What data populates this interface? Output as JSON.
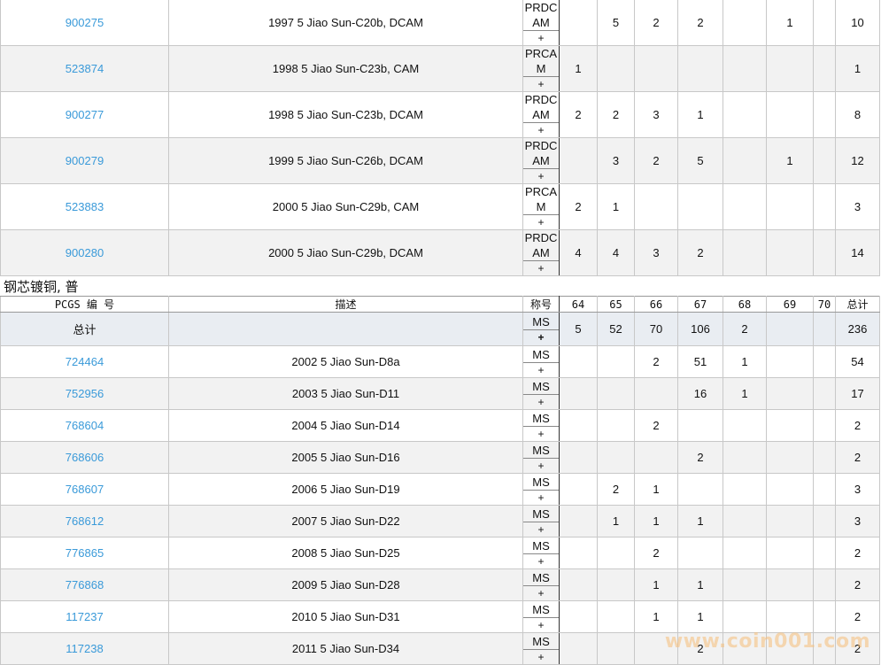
{
  "top_table": {
    "rows": [
      {
        "id": "900275",
        "desc": "1997 5 Jiao Sun-C20b, DCAM",
        "grade": "PRDCAM",
        "plus": "+",
        "g64": "",
        "g65": "5",
        "g66": "2",
        "g67": "2",
        "g68": "",
        "g69": "1",
        "g70": "",
        "total": "10"
      },
      {
        "id": "523874",
        "desc": "1998 5 Jiao Sun-C23b, CAM",
        "grade": "PRCAM",
        "plus": "+",
        "g64": "1",
        "g65": "",
        "g66": "",
        "g67": "",
        "g68": "",
        "g69": "",
        "g70": "",
        "total": "1"
      },
      {
        "id": "900277",
        "desc": "1998 5 Jiao Sun-C23b, DCAM",
        "grade": "PRDCAM",
        "plus": "+",
        "g64": "2",
        "g65": "2",
        "g66": "3",
        "g67": "1",
        "g68": "",
        "g69": "",
        "g70": "",
        "total": "8"
      },
      {
        "id": "900279",
        "desc": "1999 5 Jiao Sun-C26b, DCAM",
        "grade": "PRDCAM",
        "plus": "+",
        "g64": "",
        "g65": "3",
        "g66": "2",
        "g67": "5",
        "g68": "",
        "g69": "1",
        "g70": "",
        "total": "12"
      },
      {
        "id": "523883",
        "desc": "2000 5 Jiao Sun-C29b, CAM",
        "grade": "PRCAM",
        "plus": "+",
        "g64": "2",
        "g65": "1",
        "g66": "",
        "g67": "",
        "g68": "",
        "g69": "",
        "g70": "",
        "total": "3"
      },
      {
        "id": "900280",
        "desc": "2000 5 Jiao Sun-C29b, DCAM",
        "grade": "PRDCAM",
        "plus": "+",
        "g64": "4",
        "g65": "4",
        "g66": "3",
        "g67": "2",
        "g68": "",
        "g69": "",
        "g70": "",
        "total": "14"
      }
    ]
  },
  "section": {
    "title": "钢芯镀铜, 普"
  },
  "bottom_table": {
    "headers": {
      "pcgs": "PCGS 编 号",
      "desc": "描述",
      "grade": "称号",
      "g64": "64",
      "g65": "65",
      "g66": "66",
      "g67": "67",
      "g68": "68",
      "g69": "69",
      "g70": "70",
      "total": "总计"
    },
    "total_row": {
      "label": "总计",
      "grade": "MS",
      "plus": "+",
      "g64": "5",
      "g65": "52",
      "g66": "70",
      "g67": "106",
      "g68": "2",
      "g69": "",
      "g70": "",
      "total": "236"
    },
    "rows": [
      {
        "id": "724464",
        "desc": "2002 5 Jiao Sun-D8a",
        "grade": "MS",
        "plus": "+",
        "g64": "",
        "g65": "",
        "g66": "2",
        "g67": "51",
        "g68": "1",
        "g69": "",
        "g70": "",
        "total": "54"
      },
      {
        "id": "752956",
        "desc": "2003 5 Jiao Sun-D11",
        "grade": "MS",
        "plus": "+",
        "g64": "",
        "g65": "",
        "g66": "",
        "g67": "16",
        "g68": "1",
        "g69": "",
        "g70": "",
        "total": "17"
      },
      {
        "id": "768604",
        "desc": "2004 5 Jiao Sun-D14",
        "grade": "MS",
        "plus": "+",
        "g64": "",
        "g65": "",
        "g66": "2",
        "g67": "",
        "g68": "",
        "g69": "",
        "g70": "",
        "total": "2"
      },
      {
        "id": "768606",
        "desc": "2005 5 Jiao Sun-D16",
        "grade": "MS",
        "plus": "+",
        "g64": "",
        "g65": "",
        "g66": "",
        "g67": "2",
        "g68": "",
        "g69": "",
        "g70": "",
        "total": "2"
      },
      {
        "id": "768607",
        "desc": "2006 5 Jiao Sun-D19",
        "grade": "MS",
        "plus": "+",
        "g64": "",
        "g65": "2",
        "g66": "1",
        "g67": "",
        "g68": "",
        "g69": "",
        "g70": "",
        "total": "3"
      },
      {
        "id": "768612",
        "desc": "2007 5 Jiao Sun-D22",
        "grade": "MS",
        "plus": "+",
        "g64": "",
        "g65": "1",
        "g66": "1",
        "g67": "1",
        "g68": "",
        "g69": "",
        "g70": "",
        "total": "3"
      },
      {
        "id": "776865",
        "desc": "2008 5 Jiao Sun-D25",
        "grade": "MS",
        "plus": "+",
        "g64": "",
        "g65": "",
        "g66": "2",
        "g67": "",
        "g68": "",
        "g69": "",
        "g70": "",
        "total": "2"
      },
      {
        "id": "776868",
        "desc": "2009 5 Jiao Sun-D28",
        "grade": "MS",
        "plus": "+",
        "g64": "",
        "g65": "",
        "g66": "1",
        "g67": "1",
        "g68": "",
        "g69": "",
        "g70": "",
        "total": "2"
      },
      {
        "id": "117237",
        "desc": "2010 5 Jiao Sun-D31",
        "grade": "MS",
        "plus": "+",
        "g64": "",
        "g65": "",
        "g66": "1",
        "g67": "1",
        "g68": "",
        "g69": "",
        "g70": "",
        "total": "2"
      },
      {
        "id": "117238",
        "desc": "2011 5 Jiao Sun-D34",
        "grade": "MS",
        "plus": "+",
        "g64": "",
        "g65": "",
        "g66": "",
        "g67": "2",
        "g68": "",
        "g69": "",
        "g70": "",
        "total": "2"
      }
    ]
  },
  "watermark": {
    "text": "www.coin001.com"
  },
  "colors": {
    "link": "#3a9ad9",
    "stripe": "#f2f2f2",
    "total_row": "#e9edf2"
  }
}
